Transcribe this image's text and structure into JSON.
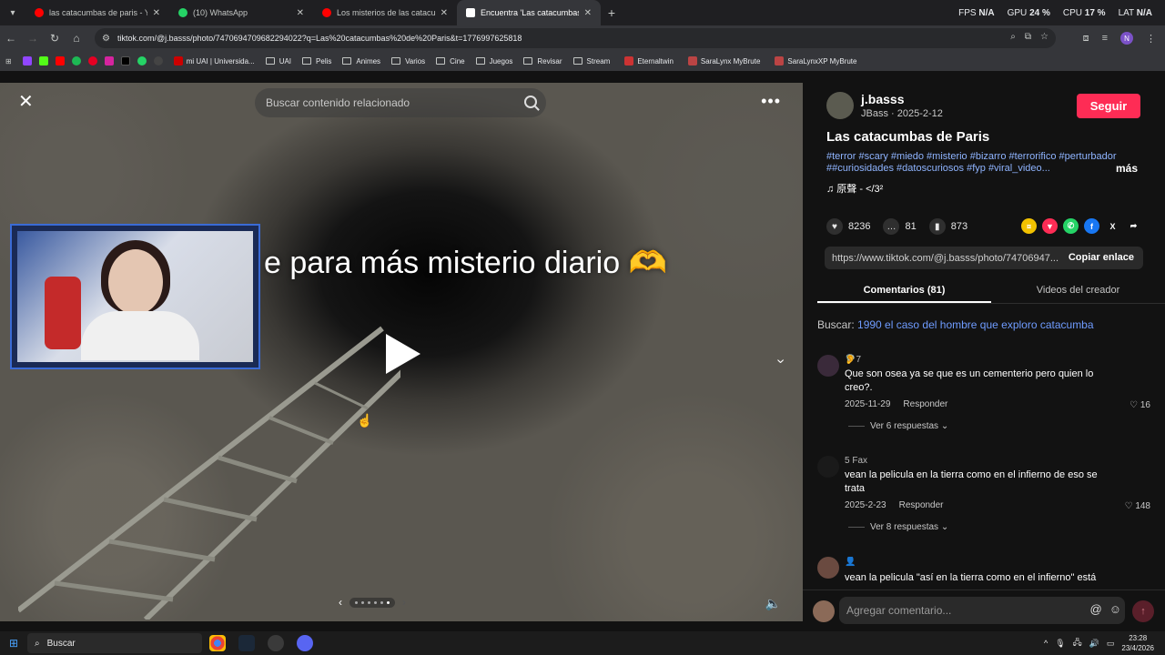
{
  "browser": {
    "tabs": [
      {
        "title": "las catacumbas de paris - YouTu",
        "favicon_color": "#ff0000",
        "active": false
      },
      {
        "title": "(10) WhatsApp",
        "favicon_color": "#25d366",
        "active": false
      },
      {
        "title": "Los misterios de las catacumba",
        "favicon_color": "#ff0000",
        "active": false
      },
      {
        "title": "Encuentra 'Las catacumbas de P",
        "favicon_color": "#ffffff",
        "active": true
      }
    ],
    "perf": {
      "fps_label": "FPS",
      "fps_value": "N/A",
      "gpu_label": "GPU",
      "gpu_value": "24 %",
      "cpu_label": "CPU",
      "cpu_value": "17 %",
      "lat_label": "LAT",
      "lat_value": "N/A"
    },
    "url": "tiktok.com/@j.basss/photo/7470694709682294022?q=Las%20catacumbas%20de%20Paris&t=1776997625818",
    "profile_initial": "N",
    "bookmarks": [
      {
        "label": "mi UAI | Universida...",
        "type": "site"
      },
      {
        "label": "UAI",
        "type": "folder"
      },
      {
        "label": "Pelis",
        "type": "folder"
      },
      {
        "label": "Animes",
        "type": "folder"
      },
      {
        "label": "Varios",
        "type": "folder"
      },
      {
        "label": "Cine",
        "type": "folder"
      },
      {
        "label": "Juegos",
        "type": "folder"
      },
      {
        "label": "Revisar",
        "type": "folder"
      },
      {
        "label": "Stream",
        "type": "folder"
      },
      {
        "label": "Eternaltwin",
        "type": "site"
      },
      {
        "label": "SaraLynx MyBrute",
        "type": "site"
      },
      {
        "label": "SaraLynxXP MyBrute",
        "type": "site"
      }
    ]
  },
  "viewer": {
    "search_placeholder": "Buscar contenido relacionado",
    "caption_text": "e para más misterio diario",
    "caption_emoji": "🫶"
  },
  "post": {
    "username": "j.basss",
    "display_and_date": "JBass · 2025-2-12",
    "follow_label": "Seguir",
    "title": "Las catacumbas de Paris",
    "hashtags": "#terror #scary #miedo #misterio #bizarro #terrorifico #perturbador ##curiosidades #datoscuriosos #fyp #viral_video...",
    "more_label": "más",
    "music": "♫  原聲 - </3²",
    "likes": "8236",
    "comments": "81",
    "saves": "873",
    "link": "https://www.tiktok.com/@j.basss/photo/74706947...",
    "copy_label": "Copiar enlace",
    "tab_comments": "Comentarios (81)",
    "tab_creator": "Videos del creador",
    "search_prefix": "Buscar:",
    "search_query": "1990 el caso del hombre que exploro catacumba",
    "comment_placeholder": "Agregar comentario..."
  },
  "comments": [
    {
      "user": "🦻7",
      "text": "Que son osea ya se que es un cementerio pero quien lo creo?.",
      "date": "2025-11-29",
      "reply_label": "Responder",
      "likes": "16",
      "replies": "Ver 6 respuestas"
    },
    {
      "user": "5 Fax",
      "text": "vean la pelicula en la tierra como en el infierno de eso se trata",
      "date": "2025-2-23",
      "reply_label": "Responder",
      "likes": "148",
      "replies": "Ver 8 respuestas"
    },
    {
      "user": "👤",
      "text": "vean la pelicula \"así en la tierra como en el infierno\" está",
      "date": "",
      "reply_label": "",
      "likes": "",
      "replies": ""
    }
  ],
  "taskbar": {
    "search_label": "Buscar",
    "time": "23:28",
    "date": "23/4/2026"
  }
}
